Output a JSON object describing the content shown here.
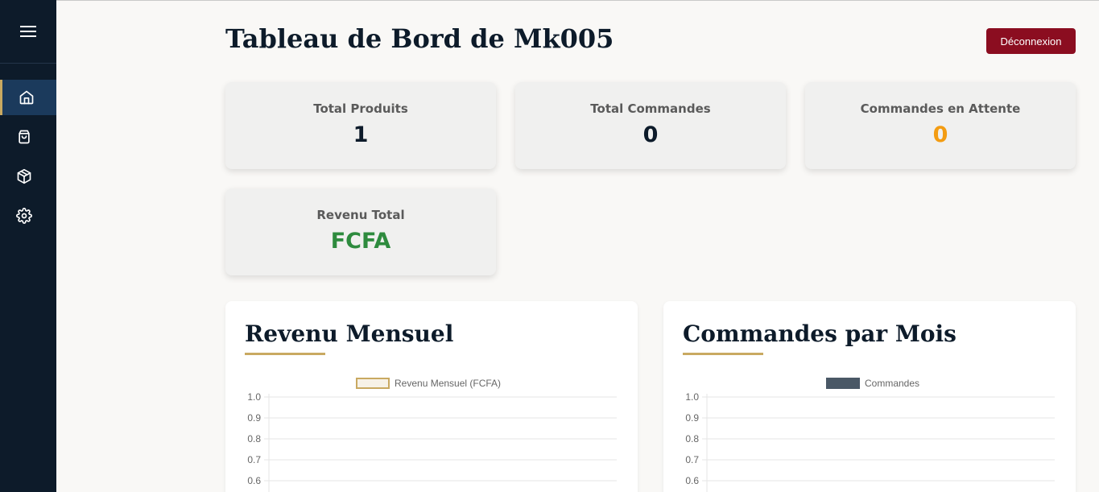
{
  "sidebar": {
    "items": [
      {
        "name": "home",
        "icon": "home-icon"
      },
      {
        "name": "orders",
        "icon": "shopping-bag-icon"
      },
      {
        "name": "products",
        "icon": "package-icon"
      },
      {
        "name": "settings",
        "icon": "gear-icon"
      }
    ],
    "active": "home"
  },
  "header": {
    "title": "Tableau de Bord de Mk005",
    "logout_label": "Déconnexion"
  },
  "stats": {
    "total_products": {
      "label": "Total Produits",
      "value": "1"
    },
    "total_orders": {
      "label": "Total Commandes",
      "value": "0"
    },
    "pending_orders": {
      "label": "Commandes en Attente",
      "value": "0"
    },
    "total_revenue": {
      "label": "Revenu Total",
      "value": "FCFA"
    }
  },
  "colors": {
    "sidebar": "#0d1b2a",
    "accent_gold": "#c9a961",
    "logout": "#8b0d20",
    "pending": "#f39c12",
    "revenue": "#2e8b3e",
    "orders_series": "#4a5866"
  },
  "panels": {
    "revenue": {
      "title": "Revenu Mensuel"
    },
    "orders": {
      "title": "Commandes par Mois"
    }
  },
  "chart_data": [
    {
      "type": "bar",
      "legend": "top",
      "grid": true,
      "series": [
        {
          "name": "Revenu Mensuel (FCFA)",
          "values": [],
          "color": "#c9a961"
        }
      ],
      "ylim": [
        0,
        1.0
      ],
      "y_ticks": [
        "1.0",
        "0.9",
        "0.8",
        "0.7",
        "0.6"
      ]
    },
    {
      "type": "bar",
      "legend": "top",
      "grid": true,
      "series": [
        {
          "name": "Commandes",
          "values": [],
          "color": "#4a5866"
        }
      ],
      "ylim": [
        0,
        1.0
      ],
      "y_ticks": [
        "1.0",
        "0.9",
        "0.8",
        "0.7",
        "0.6"
      ]
    }
  ]
}
